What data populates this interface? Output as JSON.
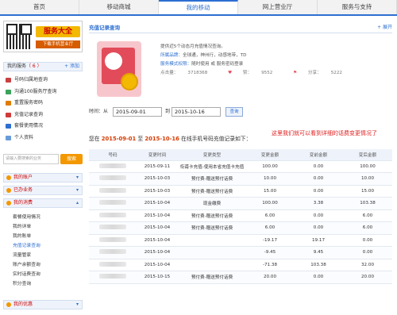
{
  "nav": {
    "tabs": [
      {
        "label": "首页"
      },
      {
        "label": "移动商城"
      },
      {
        "label": "我的移动",
        "active": true
      },
      {
        "label": "网上营业厅"
      },
      {
        "label": "服务与支持"
      }
    ]
  },
  "sidebar": {
    "qr": {
      "title": "服务大全",
      "subtitle": "下载手机营业厅"
    },
    "services": {
      "title": "我的服务",
      "count": "（ 6 ）",
      "add_label": "+ 添加",
      "items": [
        {
          "label": "号码归属地查询",
          "icon_color": "#c94040",
          "icon": "location-icon"
        },
        {
          "label": "沟通100服务厅查询",
          "icon_color": "#3aa35a",
          "icon": "store-icon"
        },
        {
          "label": "重置服务密码",
          "icon_color": "#e07c00",
          "icon": "key-icon"
        },
        {
          "label": "充值记录查询",
          "icon_color": "#d03a3a",
          "icon": "calendar-icon"
        },
        {
          "label": "套餐使用情况",
          "icon_color": "#2d6fd1",
          "icon": "chart-icon"
        },
        {
          "label": "个人资料",
          "icon_color": "#6a9bd8",
          "icon": "user-icon"
        }
      ]
    },
    "search": {
      "placeholder": "请输入要搜索的业务",
      "button": "搜索"
    },
    "accordion": [
      {
        "label": "我的账户"
      },
      {
        "label": "已办业务"
      },
      {
        "label": "我的消费"
      }
    ],
    "consume_items": [
      {
        "label": "套餐使用情况"
      },
      {
        "label": "我的详单"
      },
      {
        "label": "我的账单"
      },
      {
        "label": "充值记录查询",
        "active": true
      },
      {
        "label": "流量管家"
      },
      {
        "label": "账户余额查询"
      },
      {
        "label": "实时话费查询"
      },
      {
        "label": "积分查询"
      }
    ],
    "bottom_accordion": {
      "label": "我的优惠"
    }
  },
  "main": {
    "panel_title": "充值记录查询",
    "expand_label": "+ 展开",
    "desc": {
      "line1": "提供近5个动态月充值情况查询。",
      "brand_label": "所属品牌：",
      "brand_value": "全球通，神州行，动感地带，TD",
      "method_label": "服务模式权限：",
      "method_value": "随时使用 或 服务密码登录",
      "clicks_label": "点击量：",
      "clicks_value": "3718368",
      "likes_label": "赞：",
      "likes_value": "9552",
      "shares_label": "分享：",
      "shares_value": "5222"
    },
    "time": {
      "label": "时间：从",
      "from": "2015-09-01",
      "to_label": "到",
      "to": "2015-10-16",
      "query_button": "查询"
    },
    "summary": {
      "prefix": "您在",
      "from": "2015-09-01",
      "mid": "至",
      "to": "2015-10-16",
      "suffix": "在线手机号码充值记录如下："
    },
    "note": "这里我们就可以看到详细的话费变更情况了"
  },
  "table": {
    "headers": [
      "号码",
      "变更时间",
      "变更类型",
      "变更金额",
      "变前金额",
      "变后金额"
    ],
    "rows": [
      {
        "time": "2015-09-11",
        "type": "衔甫卡充值-使用本省充值卡充值",
        "change": "100.00",
        "before": "0.00",
        "after": "100.00"
      },
      {
        "time": "2015-10-03",
        "type": "预付费-赠送预付话费",
        "change": "10.00",
        "before": "0.00",
        "after": "10.00"
      },
      {
        "time": "2015-10-03",
        "type": "预付费-赠送预付话费",
        "change": "15.00",
        "before": "0.00",
        "after": "15.00"
      },
      {
        "time": "2015-10-04",
        "type": "现金缴费",
        "change": "100.00",
        "before": "3.38",
        "after": "103.38"
      },
      {
        "time": "2015-10-04",
        "type": "预付费-赠送预付话费",
        "change": "6.00",
        "before": "0.00",
        "after": "6.00"
      },
      {
        "time": "2015-10-04",
        "type": "预付费-赠送预付话费",
        "change": "6.00",
        "before": "0.00",
        "after": "6.00"
      },
      {
        "time": "2015-10-04",
        "type": "",
        "change": "-19.17",
        "before": "19.17",
        "after": "0.00"
      },
      {
        "time": "2015-10-04",
        "type": "",
        "change": "-9.45",
        "before": "9.45",
        "after": "0.00"
      },
      {
        "time": "2015-10-04",
        "type": "",
        "change": "-71.38",
        "before": "103.38",
        "after": "32.00"
      },
      {
        "time": "2015-10-15",
        "type": "预付费-赠送预付话费",
        "change": "20.00",
        "before": "0.00",
        "after": "20.00"
      }
    ]
  }
}
